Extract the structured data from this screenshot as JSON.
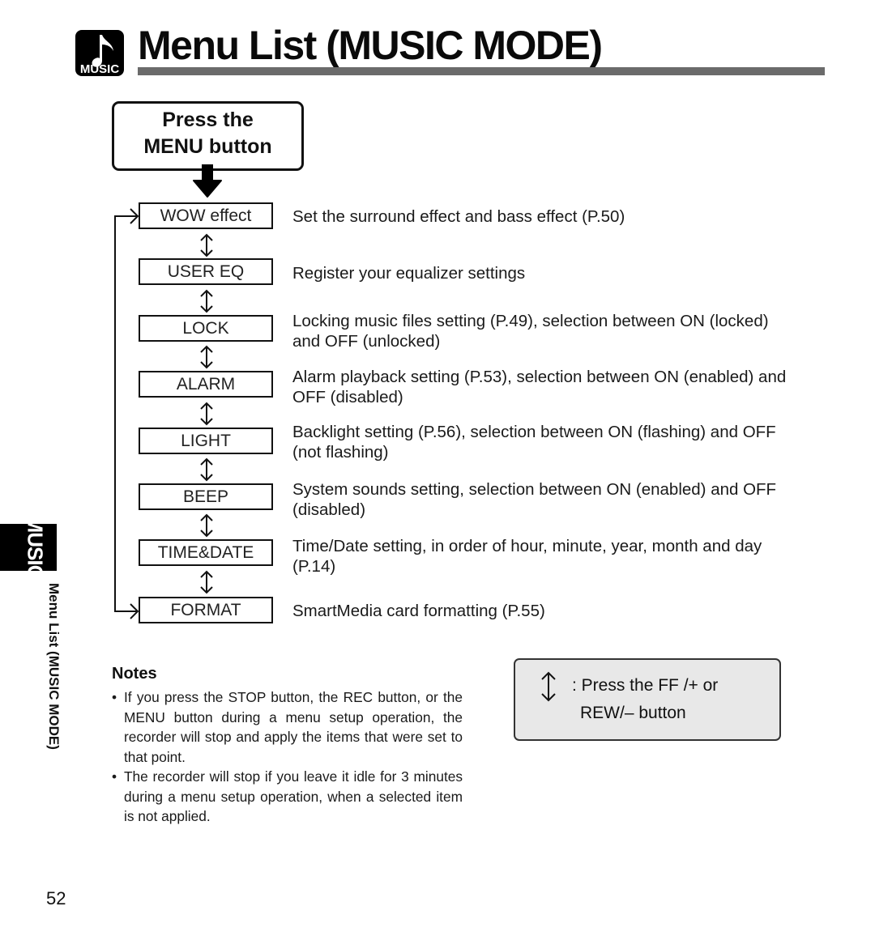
{
  "header": {
    "logo_label": "MUSIC",
    "title": "Menu List (MUSIC MODE)"
  },
  "start_box": {
    "line1": "Press the",
    "line2": "MENU button"
  },
  "menu_items": [
    {
      "label": "WOW effect",
      "description": "Set the surround effect and bass effect (P.50)"
    },
    {
      "label": "USER EQ",
      "description": "Register your equalizer settings"
    },
    {
      "label": "LOCK",
      "description": "Locking music files setting (P.49), selection between ON (locked) and OFF (unlocked)"
    },
    {
      "label": "ALARM",
      "description": "Alarm playback setting (P.53), selection between ON (enabled) and OFF (disabled)"
    },
    {
      "label": "LIGHT",
      "description": "Backlight setting (P.56), selection between ON (flashing) and OFF (not flashing)"
    },
    {
      "label": "BEEP",
      "description": "System sounds setting, selection between ON (enabled) and OFF (disabled)"
    },
    {
      "label": "TIME&DATE",
      "description": "Time/Date setting, in order of hour, minute, year, month and day (P.14)"
    },
    {
      "label": "FORMAT",
      "description": "SmartMedia card formatting (P.55)"
    }
  ],
  "side_tab": {
    "label": "MUSIC",
    "caption": "Menu List (MUSIC MODE)"
  },
  "notes": {
    "heading": "Notes",
    "items": [
      "If you press the STOP button, the REC button, or the MENU button during a menu setup operation, the recorder will stop and apply the items that were set to that point.",
      "The recorder will stop if you leave it idle for 3 minutes during a menu setup operation, when a selected item is not applied."
    ],
    "bullet": "•"
  },
  "legend": {
    "icon": "up-down-arrow-icon",
    "line1": ": Press the FF /+ or",
    "line2": "REW/– button"
  },
  "page_number": "52"
}
